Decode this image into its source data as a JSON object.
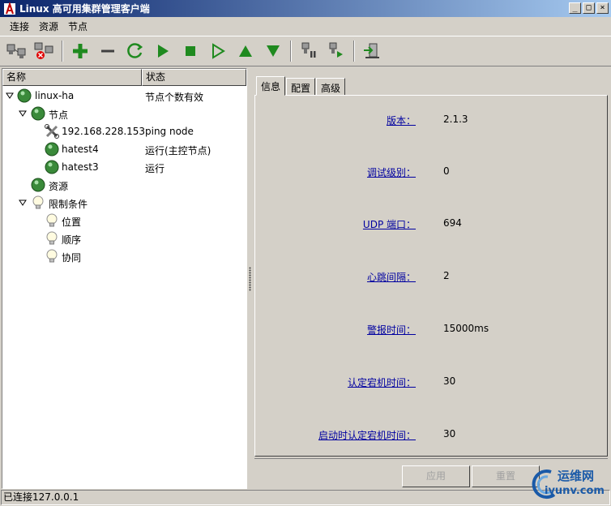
{
  "window": {
    "title": "Linux 高可用集群管理客户端"
  },
  "menu": [
    "连接",
    "资源",
    "节点"
  ],
  "toolbar": [
    {
      "icon": "connect-icon"
    },
    {
      "icon": "disconnect-icon"
    },
    {
      "icon": "add-icon"
    },
    {
      "icon": "remove-icon"
    },
    {
      "icon": "refresh-icon"
    },
    {
      "icon": "start-icon"
    },
    {
      "icon": "stop-icon"
    },
    {
      "icon": "default-icon"
    },
    {
      "icon": "move-up-icon"
    },
    {
      "icon": "move-down-icon"
    },
    {
      "icon": "standby-icon"
    },
    {
      "icon": "active-icon"
    },
    {
      "icon": "exit-icon"
    }
  ],
  "tree": {
    "headers": {
      "name": "名称",
      "status": "状态"
    },
    "items": [
      {
        "label": "linux-ha",
        "status": "节点个数有效",
        "icon": "cluster-icon",
        "expanded": true
      },
      {
        "label": "节点",
        "status": "",
        "icon": "nodes-icon",
        "expanded": true
      },
      {
        "label": "192.168.228.153",
        "status": "ping node",
        "icon": "ping-node-icon"
      },
      {
        "label": "hatest4",
        "status": "运行(主控节点)",
        "icon": "node-running-icon"
      },
      {
        "label": "hatest3",
        "status": "运行",
        "icon": "node-running-icon"
      },
      {
        "label": "资源",
        "status": "",
        "icon": "resources-icon"
      },
      {
        "label": "限制条件",
        "status": "",
        "icon": "constraints-icon",
        "expanded": true
      },
      {
        "label": "位置",
        "status": "",
        "icon": "bulb-icon"
      },
      {
        "label": "顺序",
        "status": "",
        "icon": "bulb-icon"
      },
      {
        "label": "协同",
        "status": "",
        "icon": "bulb-icon"
      }
    ]
  },
  "tabs": [
    "信息",
    "配置",
    "高级"
  ],
  "info_fields": [
    {
      "label": "版本：",
      "value": "2.1.3"
    },
    {
      "label": "调试级别：",
      "value": "0"
    },
    {
      "label": "UDP 端口：",
      "value": "694"
    },
    {
      "label": "心跳间隔：",
      "value": "2"
    },
    {
      "label": "警报时间：",
      "value": "15000ms"
    },
    {
      "label": "认定宕机时间：",
      "value": "30"
    },
    {
      "label": "启动时认定宕机时间：",
      "value": "30"
    }
  ],
  "buttons": {
    "apply": "应用",
    "reset": "重置"
  },
  "status": "已连接127.0.0.1",
  "watermark": {
    "text1": "运维网",
    "text2": "iyunv.com"
  }
}
